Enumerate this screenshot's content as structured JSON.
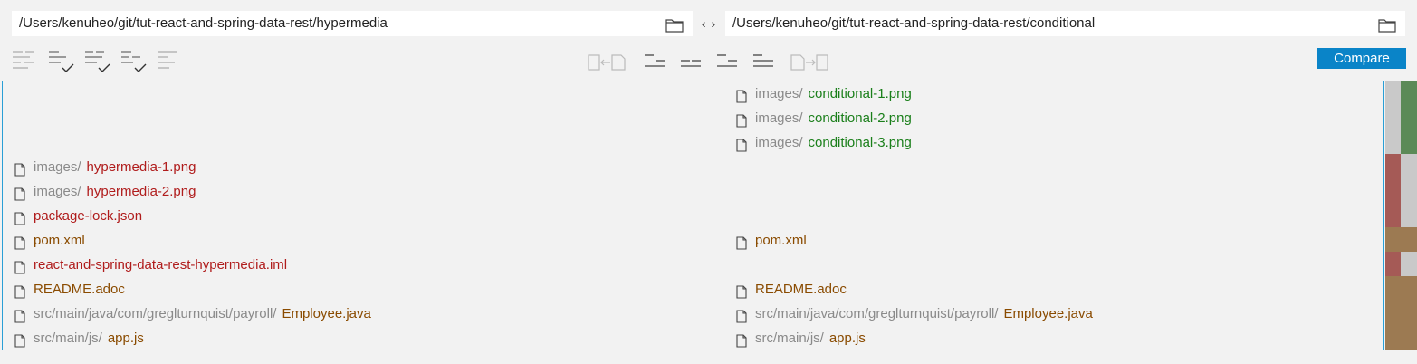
{
  "left_path": {
    "value": "/Users/kenuheo/git/tut-react-and-spring-data-rest/hypermedia"
  },
  "right_path": {
    "value": "/Users/kenuheo/git/tut-react-and-spring-data-rest/conditional"
  },
  "swap_label": "‹ ›",
  "compare_button": {
    "label": "Compare"
  },
  "colors": {
    "added": "#1a7f1a",
    "removed": "#b01c1c",
    "changed": "#8a4b00",
    "accent": "#0a84c8"
  },
  "rows": [
    {
      "side": "right",
      "dir": "images/",
      "name": "conditional-1.png",
      "status": "added"
    },
    {
      "side": "right",
      "dir": "images/",
      "name": "conditional-2.png",
      "status": "added"
    },
    {
      "side": "right",
      "dir": "images/",
      "name": "conditional-3.png",
      "status": "added"
    },
    {
      "side": "left",
      "dir": "images/",
      "name": "hypermedia-1.png",
      "status": "removed"
    },
    {
      "side": "left",
      "dir": "images/",
      "name": "hypermedia-2.png",
      "status": "removed"
    },
    {
      "side": "left",
      "dir": "",
      "name": "package-lock.json",
      "status": "removed"
    },
    {
      "side": "both",
      "dir": "",
      "name": "pom.xml",
      "status": "changed"
    },
    {
      "side": "left",
      "dir": "",
      "name": "react-and-spring-data-rest-hypermedia.iml",
      "status": "removed"
    },
    {
      "side": "both",
      "dir": "",
      "name": "README.adoc",
      "status": "changed"
    },
    {
      "side": "both",
      "dir": "src/main/java/com/greglturnquist/payroll/",
      "name": "Employee.java",
      "status": "changed"
    },
    {
      "side": "both",
      "dir": "src/main/js/",
      "name": "app.js",
      "status": "changed"
    }
  ]
}
